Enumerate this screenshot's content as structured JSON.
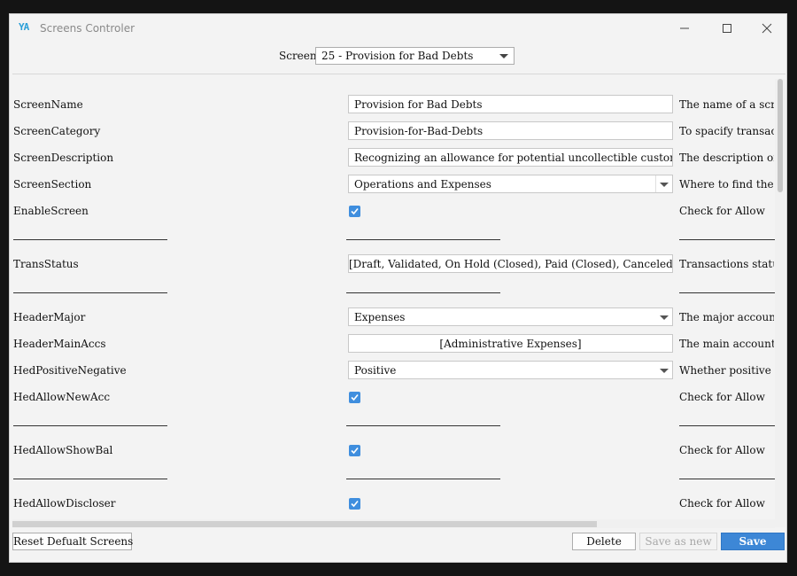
{
  "window": {
    "title": "Screens Controler",
    "logo_text": "YA"
  },
  "screen_selector": {
    "label": "Screen:",
    "value": "25 - Provision for Bad Debts"
  },
  "rows": {
    "screen_name": {
      "label": "ScreenName",
      "value": "Provision for Bad Debts",
      "desc": "The name of a screen"
    },
    "screen_category": {
      "label": "ScreenCategory",
      "value": "Provision-for-Bad-Debts",
      "desc": "To spacify transaction"
    },
    "screen_description": {
      "label": "ScreenDescription",
      "value": "Recognizing an allowance for potential uncollectible customer receivables.",
      "desc": "The description of a sc"
    },
    "screen_section": {
      "label": "ScreenSection",
      "value": "Operations and Expenses",
      "desc": "Where to find the scree"
    },
    "enable_screen": {
      "label": "EnableScreen",
      "checked": true,
      "desc": "Check for Allow"
    },
    "trans_status": {
      "label": "TransStatus",
      "value": "[Draft, Validated, On Hold (Closed), Paid (Closed), Canceled (Close...",
      "desc": "Transactions status av"
    },
    "header_major": {
      "label": "HeaderMajor",
      "value": "Expenses",
      "desc": "The major account for"
    },
    "header_main_accs": {
      "label": "HeaderMainAccs",
      "value": "[Administrative Expenses]",
      "desc": "The main accounts for"
    },
    "hed_positive_negative": {
      "label": "HedPositiveNegative",
      "value": "Positive",
      "desc": "Whether positive or ne"
    },
    "hed_allow_new_acc": {
      "label": "HedAllowNewAcc",
      "checked": true,
      "desc": "Check for Allow"
    },
    "hed_allow_show_bal": {
      "label": "HedAllowShowBal",
      "checked": true,
      "desc": "Check for Allow"
    },
    "hed_allow_discloser": {
      "label": "HedAllowDiscloser",
      "checked": true,
      "desc": "Check for Allow"
    }
  },
  "footer": {
    "reset_label": "Reset Defualt Screens",
    "delete_label": "Delete",
    "save_as_new_label": "Save as new",
    "save_label": "Save"
  },
  "colors": {
    "accent": "#3d87d6",
    "checkbox": "#3f8ede",
    "logo": "#2a9fd8"
  }
}
